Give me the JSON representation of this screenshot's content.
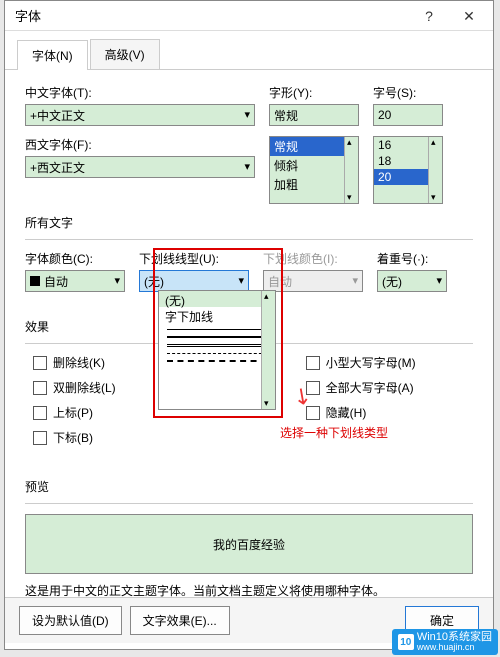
{
  "title": "字体",
  "tabs": {
    "font": "字体(N)",
    "advanced": "高级(V)"
  },
  "cn_font": {
    "label": "中文字体(T):",
    "value": "+中文正文"
  },
  "style": {
    "label": "字形(Y):",
    "value": "常规",
    "options": [
      "常规",
      "倾斜",
      "加粗"
    ]
  },
  "size": {
    "label": "字号(S):",
    "value": "20",
    "options": [
      "16",
      "18",
      "20"
    ]
  },
  "en_font": {
    "label": "西文字体(F):",
    "value": "+西文正文"
  },
  "all_text": "所有文字",
  "font_color": {
    "label": "字体颜色(C):",
    "value": "自动"
  },
  "underline_style": {
    "label": "下划线线型(U):",
    "value": "(无)",
    "opt_none": "(无)",
    "opt_words": "字下加线"
  },
  "underline_color": {
    "label": "下划线颜色(I):",
    "value": "自动"
  },
  "emphasis": {
    "label": "着重号(·):",
    "value": "(无)"
  },
  "effects_title": "效果",
  "effects": {
    "strikethrough": "删除线(K)",
    "double_strike": "双删除线(L)",
    "superscript": "上标(P)",
    "subscript": "下标(B)",
    "small_caps": "小型大写字母(M)",
    "all_caps": "全部大写字母(A)",
    "hidden": "隐藏(H)"
  },
  "annotation": "选择一种下划线类型",
  "preview_title": "预览",
  "preview_text": "我的百度经验",
  "preview_note": "这是用于中文的正文主题字体。当前文档主题定义将使用哪种字体。",
  "footer": {
    "default": "设为默认值(D)",
    "text_effects": "文字效果(E)...",
    "ok": "确定"
  },
  "watermark": {
    "brand": "Win10系统家园",
    "url": "www.huajin.cn",
    "badge": "10"
  }
}
